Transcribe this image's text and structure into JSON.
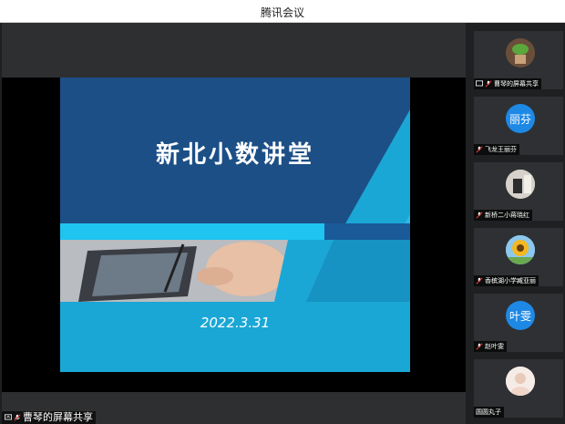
{
  "window": {
    "title": "腾讯会议"
  },
  "slide": {
    "title": "新北小数讲堂",
    "date": "2022.3.31"
  },
  "main": {
    "share_label": "曹琴的屏幕共享"
  },
  "participants": [
    {
      "name": "曹琴的屏幕共享",
      "avatar_type": "photo-plant"
    },
    {
      "name": "飞龙王丽芬",
      "avatar_text": "丽芬",
      "avatar_color": "#1e88e5"
    },
    {
      "name": "新桥二小蒋晓红",
      "avatar_type": "photo-room"
    },
    {
      "name": "香槟湖小学臧亚丽",
      "avatar_type": "photo-sunflower"
    },
    {
      "name": "赵叶雯",
      "avatar_text": "叶雯",
      "avatar_color": "#1e88e5"
    },
    {
      "name": "圆圆丸子",
      "avatar_type": "photo-person"
    }
  ],
  "colors": {
    "slide_dark": "#1c4f86",
    "slide_light": "#1aa7d6",
    "accent_bar": "#1fc4f0"
  }
}
